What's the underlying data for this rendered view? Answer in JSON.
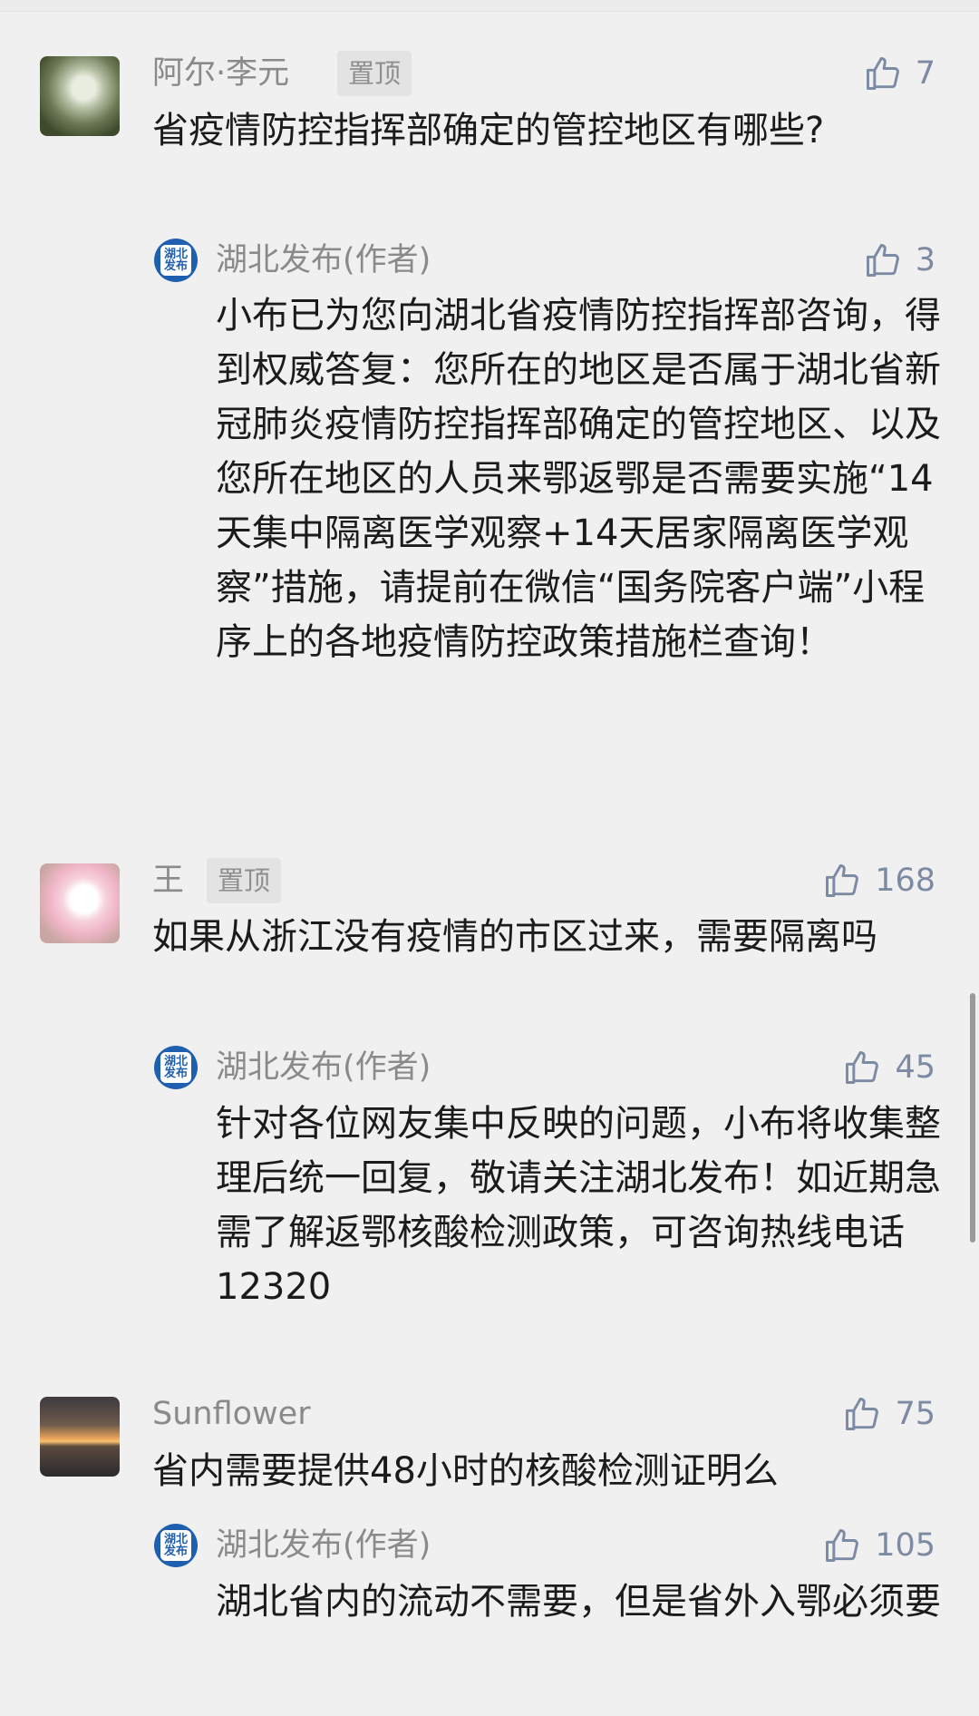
{
  "comments": [
    {
      "user": "阿尔·李元",
      "pinned_label": "置顶",
      "likes": "7",
      "text": "省疫情防控指挥部确定的管控地区有哪些?",
      "reply": {
        "author": "湖北发布(作者)",
        "logo_text": "湖北发布",
        "likes": "3",
        "text": "小布已为您向湖北省疫情防控指挥部咨询，得到权威答复：您所在的地区是否属于湖北省新冠肺炎疫情防控指挥部确定的管控地区、以及您所在地区的人员来鄂返鄂是否需要实施“14天集中隔离医学观察+14天居家隔离医学观察”措施，请提前在微信“国务院客户端”小程序上的各地疫情防控政策措施栏查询！"
      }
    },
    {
      "user": "王",
      "pinned_label": "置顶",
      "likes": "168",
      "text": "如果从浙江没有疫情的市区过来，需要隔离吗",
      "reply": {
        "author": "湖北发布(作者)",
        "logo_text": "湖北发布",
        "likes": "45",
        "text": "针对各位网友集中反映的问题，小布将收集整理后统一回复，敬请关注湖北发布！如近期急需了解返鄂核酸检测政策，可咨询热线电话12320"
      }
    },
    {
      "user": "Sunflower",
      "likes": "75",
      "text": "省内需要提供48小时的核酸检测证明么",
      "reply": {
        "author": "湖北发布(作者)",
        "logo_text": "湖北发布",
        "likes": "105",
        "text": "湖北省内的流动不需要，但是省外入鄂必须要"
      }
    }
  ],
  "icons": {
    "like": "thumbs-up-icon",
    "logo": "hubei-fabu-logo"
  },
  "colors": {
    "background": "#f0f0f0",
    "name": "#8a8a8a",
    "like": "#7d8aa3",
    "logo": "#1f5fb0",
    "text": "#1b1b1b"
  }
}
